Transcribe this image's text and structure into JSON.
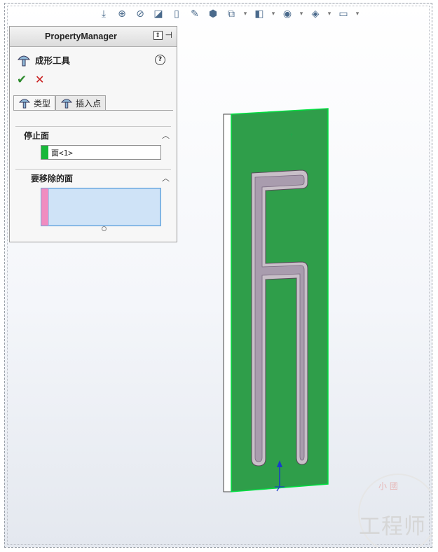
{
  "property_manager": {
    "header_title": "PropertyManager",
    "tool_name": "成形工具",
    "help_icon": "?",
    "ok_icon": "✔",
    "cancel_icon": "✕",
    "tabs": [
      {
        "label": "类型",
        "active": true
      },
      {
        "label": "插入点",
        "active": false
      }
    ],
    "groups": {
      "stop_face": {
        "label": "停止面",
        "value": "面<1>",
        "swatch_color": "#18b83a"
      },
      "faces_to_remove": {
        "label": "要移除的面",
        "value": "",
        "swatch_color": "#f08cc0"
      }
    }
  },
  "watermark": {
    "main": "工程师",
    "sub": "小 國"
  },
  "colors": {
    "part_face": "#2f9e4a",
    "part_edge": "#00e040",
    "slot": "#c8bfc8",
    "triad_axis": "#1a3cc8"
  }
}
